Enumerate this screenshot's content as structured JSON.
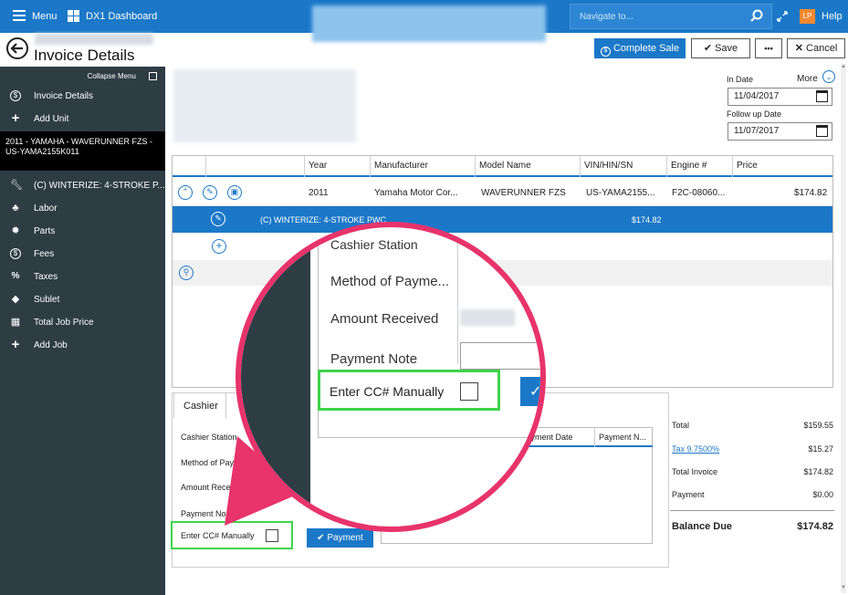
{
  "topbar": {
    "menu": "Menu",
    "dashboard": "DX1 Dashboard",
    "search_placeholder": "Navigate to...",
    "user_initials": "LP",
    "help": "Help"
  },
  "page": {
    "title": "Invoice Details"
  },
  "toolbar": {
    "complete_sale": "Complete Sale",
    "save": "Save",
    "more_dots": "•••",
    "cancel": "Cancel"
  },
  "sidebar": {
    "collapse": "Collapse Menu",
    "items": [
      {
        "label": "Invoice Details",
        "icon": "dollar-circle-icon"
      },
      {
        "label": "Add Unit",
        "icon": "plus-icon"
      }
    ],
    "unit": "2011 - YAMAHA - WAVERUNNER FZS - US-YAMA2155K011",
    "job_items": [
      {
        "label": "(C) WINTERIZE: 4-STROKE P...",
        "icon": "wrench-icon"
      },
      {
        "label": "Labor",
        "icon": "people-icon"
      },
      {
        "label": "Parts",
        "icon": "gear-icon"
      },
      {
        "label": "Fees",
        "icon": "dollar-circle-icon"
      },
      {
        "label": "Taxes",
        "icon": "percent-tax-icon"
      },
      {
        "label": "Sublet",
        "icon": "tag-icon"
      },
      {
        "label": "Total Job Price",
        "icon": "calculator-icon"
      },
      {
        "label": "Add Job",
        "icon": "plus-icon"
      }
    ]
  },
  "dates": {
    "in_date_label": "In Date",
    "in_date": "11/04/2017",
    "more": "More",
    "followup_label": "Follow up Date",
    "followup_date": "11/07/2017"
  },
  "table": {
    "headers": [
      "Year",
      "Manufacturer",
      "Model Name",
      "VIN/HIN/SN",
      "Engine #",
      "Price"
    ],
    "row": {
      "year": "2011",
      "manufacturer": "Yamaha Motor Cor...",
      "model": "WAVERUNNER FZS",
      "vin": "US-YAMA2155...",
      "engine": "F2C-08060...",
      "price": "$174.82"
    },
    "job": {
      "name": "(C) WINTERIZE: 4-STROKE PWC",
      "price": "$174.82"
    }
  },
  "cashier": {
    "tab": "Cashier",
    "station_label": "Cashier Station",
    "method_label": "Method of Payme...",
    "amount_label": "Amount Receiv...",
    "note_label": "Payment No...",
    "cc_label": "Enter CC# Manually",
    "payment_button": "Payment",
    "col_payment_date": "...yment Date",
    "col_payment_n": "Payment N..."
  },
  "zoom": {
    "station": "Cashier Station",
    "method": "Method of Payme...",
    "amount": "Amount Received",
    "note": "Payment Note",
    "cc": "Enter CC# Manually"
  },
  "totals": {
    "total_label": "Total",
    "total": "$159.55",
    "tax_label": "Tax 9.7500%",
    "tax": "$15.27",
    "invoice_label": "Total Invoice",
    "invoice": "$174.82",
    "payment_label": "Payment",
    "payment": "$0.00",
    "balance_label": "Balance Due",
    "balance": "$174.82"
  },
  "colors": {
    "accent": "#1b78c8",
    "highlight_green": "#3fd34a",
    "callout_pink": "#e8336b",
    "sidebar": "#2e3c44"
  }
}
